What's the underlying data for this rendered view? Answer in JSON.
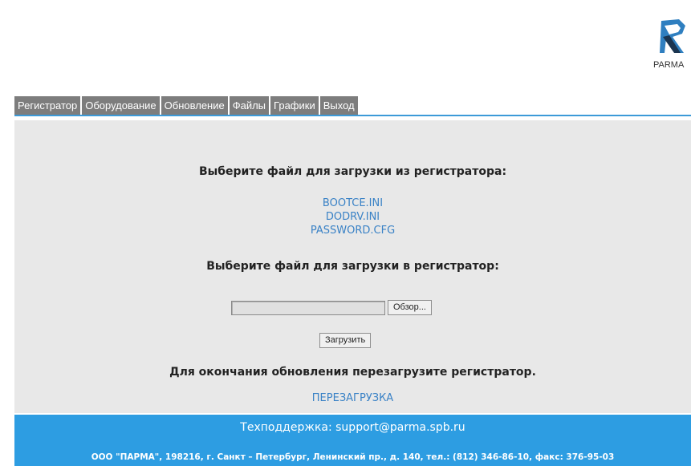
{
  "logo": {
    "text": "PARMA",
    "icon": "parma-logo-icon"
  },
  "nav": {
    "tabs": [
      "Регистратор",
      "Оборудование",
      "Обновление",
      "Файлы",
      "Графики",
      "Выход"
    ]
  },
  "main": {
    "download_heading": "Выберите файл для загрузки из регистратора:",
    "files": [
      "BOOTCE.INI",
      "DODRV.INI",
      "PASSWORD.CFG"
    ],
    "upload_heading": "Выберите файл для загрузки в регистратор:",
    "file_input_value": "",
    "browse_label": "Обзор...",
    "upload_label": "Загрузить",
    "reboot_heading": "Для окончания обновления перезагрузите регистратор.",
    "reboot_link": "ПЕРЕЗАГРУЗКА"
  },
  "footer": {
    "support": "Техподдержка: support@parma.spb.ru",
    "address": "ООО \"ПАРМА\", 198216, г. Санкт – Петербург, Ленинский пр., д. 140, тел.: (812) 346-86-10, факс: 376-95-03"
  },
  "colors": {
    "accent": "#2d9de2",
    "tab": "#7d7d7d",
    "link": "#3a82c6",
    "panel": "#e8e8e8"
  }
}
